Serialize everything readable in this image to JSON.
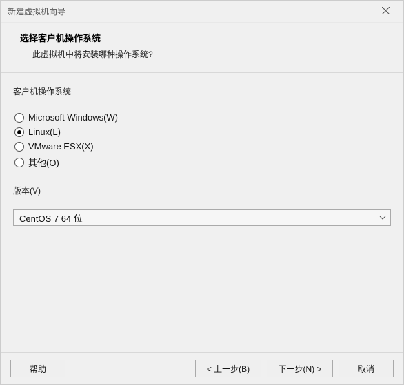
{
  "titlebar": {
    "title": "新建虚拟机向导"
  },
  "header": {
    "title": "选择客户机操作系统",
    "subtitle": "此虚拟机中将安装哪种操作系统?"
  },
  "osGroup": {
    "label": "客户机操作系统",
    "options": [
      {
        "label": "Microsoft Windows(W)",
        "selected": false
      },
      {
        "label": "Linux(L)",
        "selected": true
      },
      {
        "label": "VMware ESX(X)",
        "selected": false
      },
      {
        "label": "其他(O)",
        "selected": false
      }
    ]
  },
  "versionGroup": {
    "label": "版本(V)",
    "value": "CentOS 7 64 位"
  },
  "footer": {
    "help": "帮助",
    "back": "< 上一步(B)",
    "next": "下一步(N) >",
    "cancel": "取消"
  }
}
